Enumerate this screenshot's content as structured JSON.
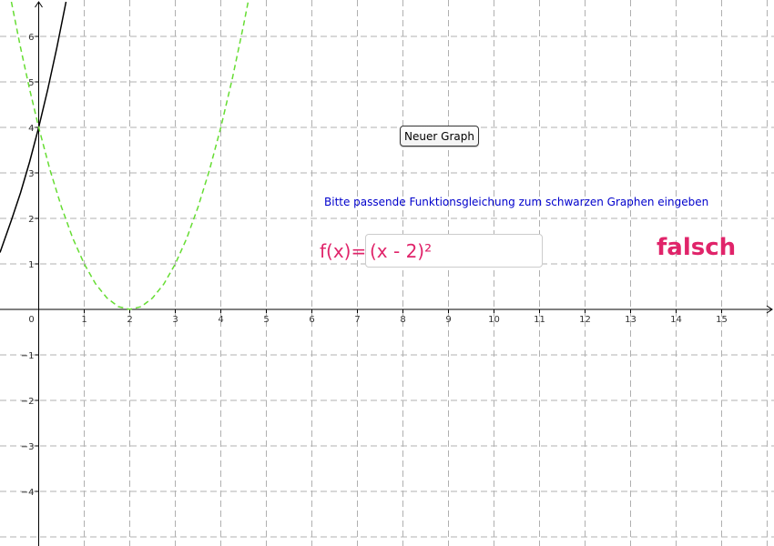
{
  "controls": {
    "new_graph_button": "Neuer Graph",
    "instruction": "Bitte passende Funktionsgleichung zum schwarzen Graphen eingeben",
    "function_label": "f(x)=",
    "function_input_value": "(x - 2)²",
    "result": "falsch"
  },
  "colors": {
    "target_graph": "#000000",
    "user_graph": "#66dd33",
    "accent": "#e0246a",
    "instruction": "#0000cc",
    "grid": "#b0b0b0"
  },
  "chart_data": {
    "type": "line",
    "x_ticks": [
      0,
      1,
      2,
      3,
      4,
      5,
      6,
      7,
      8,
      9,
      10,
      11,
      12,
      13,
      14,
      15
    ],
    "y_ticks": [
      -4,
      -3,
      -2,
      -1,
      1,
      2,
      3,
      4,
      5,
      6
    ],
    "x_tick_labels": [
      "0",
      "1",
      "2",
      "3",
      "4",
      "5",
      "6",
      "7",
      "8",
      "9",
      "10",
      "11",
      "12",
      "13",
      "14",
      "15"
    ],
    "y_tick_labels": [
      "−4",
      "−3",
      "−2",
      "−1",
      "1",
      "2",
      "3",
      "4",
      "5",
      "6"
    ],
    "xlim": [
      -0.85,
      16.15
    ],
    "ylim": [
      -5.2,
      6.8
    ],
    "grid": true,
    "series": [
      {
        "id": "target",
        "style": "solid",
        "color": "#000000",
        "x": [
          -0.85,
          -0.6,
          -0.4,
          -0.2,
          0,
          0.2,
          0.4,
          0.6
        ],
        "y": [
          1.25,
          1.96,
          2.56,
          3.24,
          4.0,
          4.84,
          5.76,
          6.76
        ]
      },
      {
        "id": "user",
        "style": "dashed",
        "color": "#66dd33",
        "x": [
          -0.6,
          -0.4,
          -0.2,
          0,
          0.25,
          0.5,
          0.75,
          1.0,
          1.25,
          1.5,
          1.75,
          2.0,
          2.25,
          2.5,
          2.75,
          3.0,
          3.25,
          3.5,
          3.75,
          4.0,
          4.25,
          4.5,
          4.6
        ],
        "y": [
          6.76,
          5.76,
          4.84,
          4.0,
          3.06,
          2.25,
          1.56,
          1.0,
          0.56,
          0.25,
          0.06,
          0.0,
          0.06,
          0.25,
          0.56,
          1.0,
          1.56,
          2.25,
          3.06,
          4.0,
          5.06,
          6.25,
          6.76
        ]
      }
    ]
  }
}
